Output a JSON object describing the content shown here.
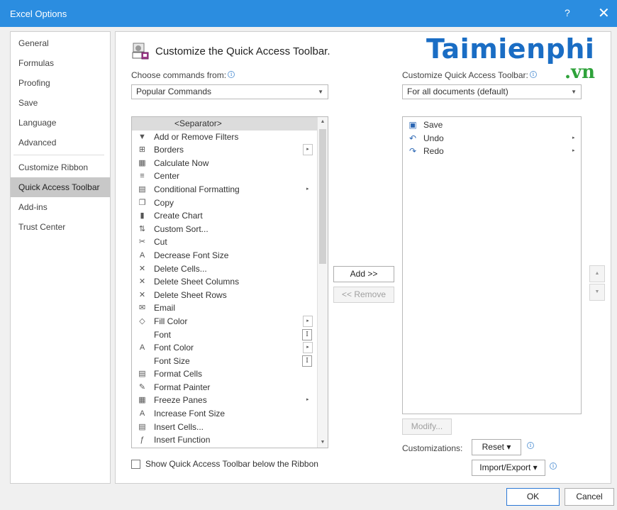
{
  "window": {
    "title": "Excel Options",
    "help": "?",
    "close": "✕"
  },
  "nav": [
    {
      "label": "General"
    },
    {
      "label": "Formulas"
    },
    {
      "label": "Proofing"
    },
    {
      "label": "Save"
    },
    {
      "label": "Language"
    },
    {
      "label": "Advanced"
    },
    {
      "label": "Customize Ribbon"
    },
    {
      "label": "Quick Access Toolbar",
      "active": true
    },
    {
      "label": "Add-ins"
    },
    {
      "label": "Trust Center"
    }
  ],
  "heading": "Customize the Quick Access Toolbar.",
  "watermark": {
    "main": "Taimienphi",
    "sub": ".vn"
  },
  "choose_label": "Choose commands from:",
  "choose_value": "Popular Commands",
  "customize_label": "Customize Quick Access Toolbar:",
  "customize_value": "For all documents (default)",
  "commands": [
    {
      "label": "<Separator>",
      "icon": ""
    },
    {
      "label": "Add or Remove Filters",
      "icon": "filter-icon",
      "glyph": "▼"
    },
    {
      "label": "Borders",
      "icon": "borders-icon",
      "glyph": "⊞",
      "box": "▸"
    },
    {
      "label": "Calculate Now",
      "icon": "calculator-icon",
      "glyph": "▦"
    },
    {
      "label": "Center",
      "icon": "align-center-icon",
      "glyph": "≡"
    },
    {
      "label": "Conditional Formatting",
      "icon": "conditional-formatting-icon",
      "glyph": "▤",
      "arrow": "▸"
    },
    {
      "label": "Copy",
      "icon": "copy-icon",
      "glyph": "❐"
    },
    {
      "label": "Create Chart",
      "icon": "chart-icon",
      "glyph": "▮"
    },
    {
      "label": "Custom Sort...",
      "icon": "sort-icon",
      "glyph": "⇅"
    },
    {
      "label": "Cut",
      "icon": "scissors-icon",
      "glyph": "✂"
    },
    {
      "label": "Decrease Font Size",
      "icon": "decrease-font-icon",
      "glyph": "A"
    },
    {
      "label": "Delete Cells...",
      "icon": "delete-cells-icon",
      "glyph": "✕"
    },
    {
      "label": "Delete Sheet Columns",
      "icon": "delete-columns-icon",
      "glyph": "✕"
    },
    {
      "label": "Delete Sheet Rows",
      "icon": "delete-rows-icon",
      "glyph": "✕"
    },
    {
      "label": "Email",
      "icon": "email-icon",
      "glyph": "✉"
    },
    {
      "label": "Fill Color",
      "icon": "fill-color-icon",
      "glyph": "◇",
      "box": "▸"
    },
    {
      "label": "Font",
      "icon": "",
      "glyph": "",
      "sizer": "I"
    },
    {
      "label": "Font Color",
      "icon": "font-color-icon",
      "glyph": "A",
      "box": "▸"
    },
    {
      "label": "Font Size",
      "icon": "",
      "glyph": "",
      "sizer": "I"
    },
    {
      "label": "Format Cells",
      "icon": "format-cells-icon",
      "glyph": "▤"
    },
    {
      "label": "Format Painter",
      "icon": "format-painter-icon",
      "glyph": "✎"
    },
    {
      "label": "Freeze Panes",
      "icon": "freeze-panes-icon",
      "glyph": "▦",
      "arrow": "▸"
    },
    {
      "label": "Increase Font Size",
      "icon": "increase-font-icon",
      "glyph": "A"
    },
    {
      "label": "Insert Cells...",
      "icon": "insert-cells-icon",
      "glyph": "▤"
    },
    {
      "label": "Insert Function",
      "icon": "function-icon",
      "glyph": "ƒ"
    },
    {
      "label": "",
      "icon": "",
      "glyph": ""
    }
  ],
  "qat_items": [
    {
      "label": "Save",
      "icon": "save-icon",
      "glyph": "▣"
    },
    {
      "label": "Undo",
      "icon": "undo-icon",
      "glyph": "↶",
      "arrow": "▸"
    },
    {
      "label": "Redo",
      "icon": "redo-icon",
      "glyph": "↷",
      "arrow": "▸"
    }
  ],
  "add_button": "Add >>",
  "remove_button": "<< Remove",
  "modify_button": "Modify...",
  "customizations_label": "Customizations:",
  "reset_button": "Reset ▾",
  "import_export_button": "Import/Export ▾",
  "show_below_label": "Show Quick Access Toolbar below the Ribbon",
  "ok_button": "OK",
  "cancel_button": "Cancel",
  "colors": {
    "titlebar": "#2b8de0",
    "brand_blue": "#1a6dc4",
    "brand_green": "#2ea23a"
  }
}
